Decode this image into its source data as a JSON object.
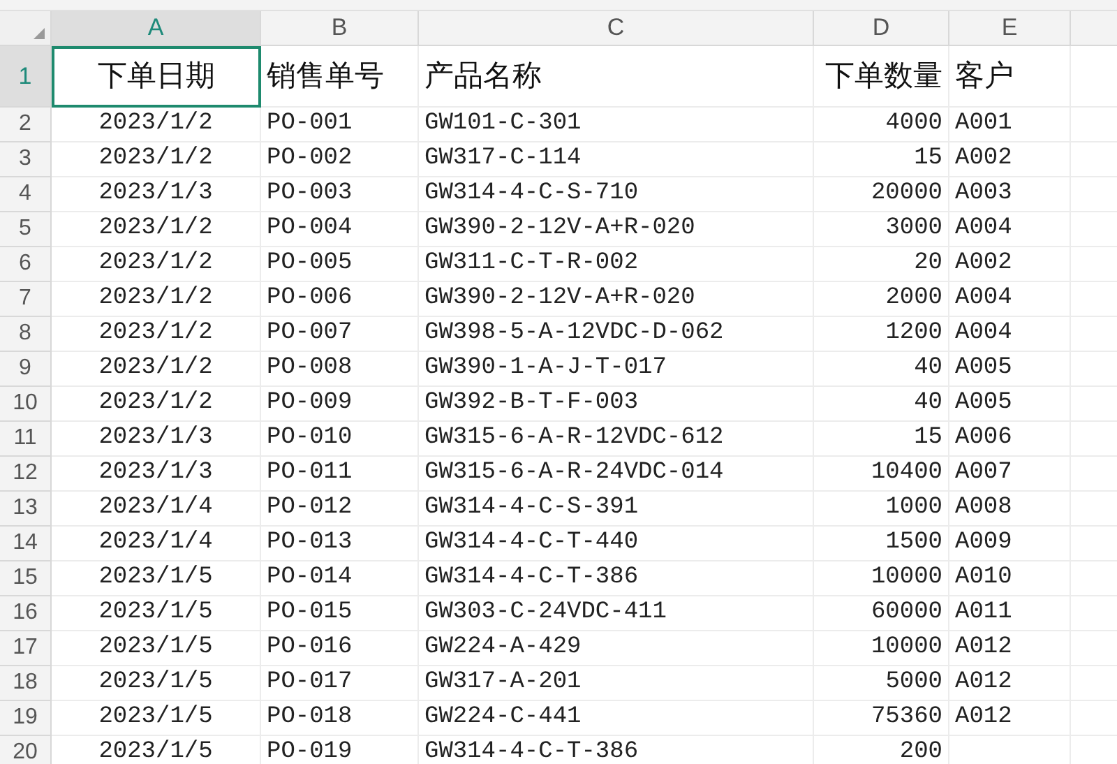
{
  "columns": [
    {
      "label": "A",
      "selected": true
    },
    {
      "label": "B",
      "selected": false
    },
    {
      "label": "C",
      "selected": false
    },
    {
      "label": "D",
      "selected": false
    },
    {
      "label": "E",
      "selected": false
    }
  ],
  "header_row": {
    "number": "1",
    "selected": true,
    "cells": [
      {
        "text": "下单日期",
        "selected": true
      },
      {
        "text": "销售单号",
        "selected": false
      },
      {
        "text": "产品名称",
        "selected": false
      },
      {
        "text": "下单数量",
        "selected": false
      },
      {
        "text": "客户",
        "selected": false
      }
    ]
  },
  "rows": [
    {
      "number": "2",
      "cells": [
        "2023/1/2",
        "PO-001",
        "GW101-C-301",
        "4000",
        "A001"
      ]
    },
    {
      "number": "3",
      "cells": [
        "2023/1/2",
        "PO-002",
        "GW317-C-114",
        "15",
        "A002"
      ]
    },
    {
      "number": "4",
      "cells": [
        "2023/1/3",
        "PO-003",
        "GW314-4-C-S-710",
        "20000",
        "A003"
      ]
    },
    {
      "number": "5",
      "cells": [
        "2023/1/2",
        "PO-004",
        "GW390-2-12V-A+R-020",
        "3000",
        "A004"
      ]
    },
    {
      "number": "6",
      "cells": [
        "2023/1/2",
        "PO-005",
        "GW311-C-T-R-002",
        "20",
        "A002"
      ]
    },
    {
      "number": "7",
      "cells": [
        "2023/1/2",
        "PO-006",
        "GW390-2-12V-A+R-020",
        "2000",
        "A004"
      ]
    },
    {
      "number": "8",
      "cells": [
        "2023/1/2",
        "PO-007",
        "GW398-5-A-12VDC-D-062",
        "1200",
        "A004"
      ]
    },
    {
      "number": "9",
      "cells": [
        "2023/1/2",
        "PO-008",
        "GW390-1-A-J-T-017",
        "40",
        "A005"
      ]
    },
    {
      "number": "10",
      "cells": [
        "2023/1/2",
        "PO-009",
        "GW392-B-T-F-003",
        "40",
        "A005"
      ]
    },
    {
      "number": "11",
      "cells": [
        "2023/1/3",
        "PO-010",
        "GW315-6-A-R-12VDC-612",
        "15",
        "A006"
      ]
    },
    {
      "number": "12",
      "cells": [
        "2023/1/3",
        "PO-011",
        "GW315-6-A-R-24VDC-014",
        "10400",
        "A007"
      ]
    },
    {
      "number": "13",
      "cells": [
        "2023/1/4",
        "PO-012",
        "GW314-4-C-S-391",
        "1000",
        "A008"
      ]
    },
    {
      "number": "14",
      "cells": [
        "2023/1/4",
        "PO-013",
        "GW314-4-C-T-440",
        "1500",
        "A009"
      ]
    },
    {
      "number": "15",
      "cells": [
        "2023/1/5",
        "PO-014",
        "GW314-4-C-T-386",
        "10000",
        "A010"
      ]
    },
    {
      "number": "16",
      "cells": [
        "2023/1/5",
        "PO-015",
        "GW303-C-24VDC-411",
        "60000",
        "A011"
      ]
    },
    {
      "number": "17",
      "cells": [
        "2023/1/5",
        "PO-016",
        "GW224-A-429",
        "10000",
        "A012"
      ]
    },
    {
      "number": "18",
      "cells": [
        "2023/1/5",
        "PO-017",
        "GW317-A-201",
        "5000",
        "A012"
      ]
    },
    {
      "number": "19",
      "cells": [
        "2023/1/5",
        "PO-018",
        "GW224-C-441",
        "75360",
        "A012"
      ]
    },
    {
      "number": "20",
      "cells": [
        "2023/1/5",
        "PO-019",
        "GW314-4-C-T-386",
        "200"
      ]
    }
  ]
}
